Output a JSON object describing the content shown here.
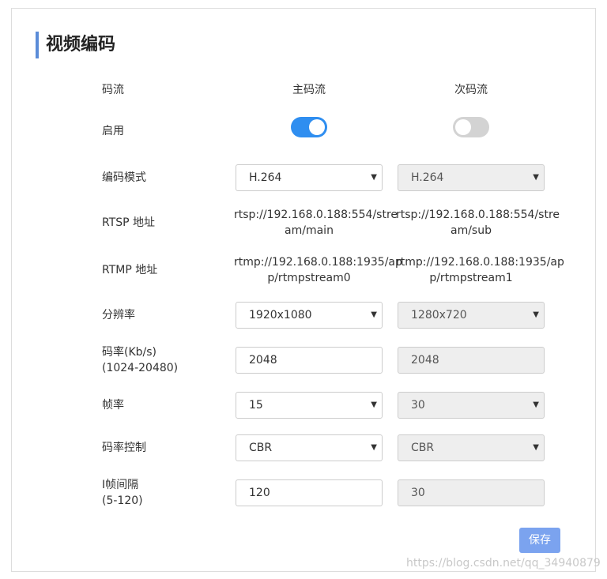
{
  "page": {
    "title": "视频编码",
    "save_label": "保存",
    "watermark": "https://blog.csdn.net/qq_34940879"
  },
  "columns": {
    "stream_label": "码流",
    "main": "主码流",
    "sub": "次码流"
  },
  "enable": {
    "label": "启用",
    "main_enabled": true,
    "sub_enabled": false
  },
  "encode_mode": {
    "label": "编码模式",
    "main": "H.264",
    "sub": "H.264"
  },
  "rtsp": {
    "label": "RTSP 地址",
    "main_line1": "rtsp://192.168.0.188:554/stre",
    "main_line2": "am/main",
    "sub_line1": "rtsp://192.168.0.188:554/stre",
    "sub_line2": "am/sub"
  },
  "rtmp": {
    "label": "RTMP 地址",
    "main_line1": "rtmp://192.168.0.188:1935/ap",
    "main_line2": "p/rtmpstream0",
    "sub_line1": "rtmp://192.168.0.188:1935/ap",
    "sub_line2": "p/rtmpstream1"
  },
  "resolution": {
    "label": "分辨率",
    "main": "1920x1080",
    "sub": "1280x720"
  },
  "bitrate": {
    "label_line1": "码率(Kb/s)",
    "label_line2": "(1024-20480)",
    "main": "2048",
    "sub": "2048"
  },
  "framerate": {
    "label": "帧率",
    "main": "15",
    "sub": "30"
  },
  "rate_control": {
    "label": "码率控制",
    "main": "CBR",
    "sub": "CBR"
  },
  "iframe": {
    "label_line1": "I帧间隔",
    "label_line2": "(5-120)",
    "main": "120",
    "sub": "30"
  },
  "colors": {
    "accent": "#2f8ef0",
    "title_bar": "#5b8cd8",
    "save_button": "#7ba3ef"
  },
  "icons": {
    "dropdown": "caret-down-icon"
  }
}
